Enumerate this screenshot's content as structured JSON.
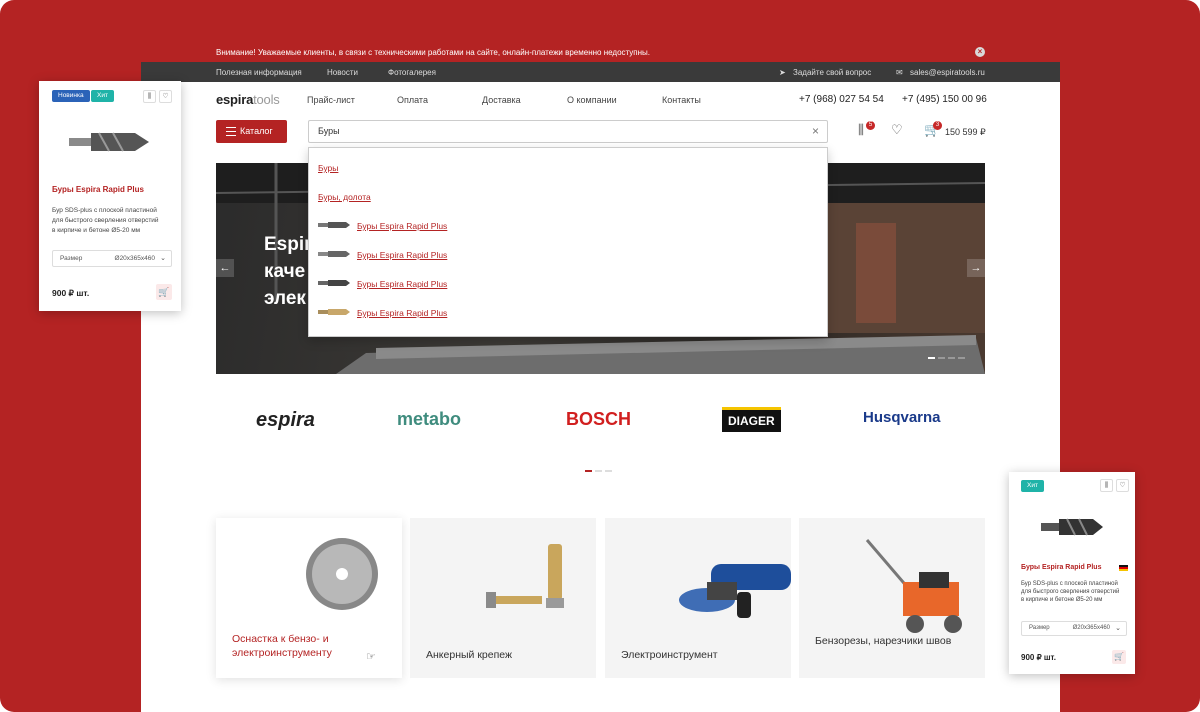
{
  "notice": {
    "text": "Внимание!  Уважаемые клиенты, в связи с техническими работами на сайте, онлайн-платежи временно недоступны.",
    "close": "×"
  },
  "topbar": {
    "links": [
      "Полезная информация",
      "Новости",
      "Фотогалерея"
    ],
    "ask": "Задайте свой вопрос",
    "email": "sales@espiratools.ru"
  },
  "header": {
    "logo_a": "espira",
    "logo_b": "tools",
    "nav": [
      "Прайс-лист",
      "Оплата",
      "Доставка",
      "О компании",
      "Контакты"
    ],
    "phone1": "+7 (968) 027 54 54",
    "phone2": "+7 (495) 150 00 96"
  },
  "catalog_label": "Каталог",
  "search": {
    "value": "Буры",
    "clear": "×"
  },
  "header_icons": {
    "compare_count": "5",
    "cart_count": "3",
    "cart_total": "150 599 ₽"
  },
  "banner": {
    "line1": "Espira",
    "line2": "каче",
    "line3": "элек"
  },
  "suggestions": [
    "Буры",
    "Буры, долота",
    "Буры Espira Rapid Plus",
    "Буры Espira Rapid Plus",
    "Буры Espira Rapid Plus",
    "Буры Espira Rapid Plus"
  ],
  "brands": [
    "espira",
    "metabo",
    "BOSCH",
    "DIAGER",
    "Husqvarna"
  ],
  "categories": [
    {
      "label": "Оснастка к бензо- и электроинструменту"
    },
    {
      "label": "Анкерный крепеж"
    },
    {
      "label": "Электроинструмент"
    },
    {
      "label": "Бензорезы, нарезчики швов"
    }
  ],
  "card_left": {
    "tag_new": "Новинка",
    "tag_hit": "Хит",
    "name": "Буры Espira Rapid Plus",
    "desc": "Бур SDS-plus с плоской пластиной для быстрого сверления отверстий в кирпиче и бетоне Ø5-20 мм",
    "size_label": "Размер",
    "size_value": "Ø20x365x460",
    "price": "900 ₽ шт."
  },
  "card_right": {
    "tag_hit": "Хит",
    "name": "Буры Espira Rapid Plus",
    "desc": "Бур SDS-plus с плоской пластиной для быстрого сверления отверстий в кирпиче и бетоне Ø5-20 мм",
    "size_label": "Размер",
    "size_value": "Ø20x365x460",
    "price": "900 ₽ шт."
  },
  "colors": {
    "brand": "#b42323",
    "tag_new": "#2b63b8",
    "tag_hit": "#1fb3a8"
  }
}
